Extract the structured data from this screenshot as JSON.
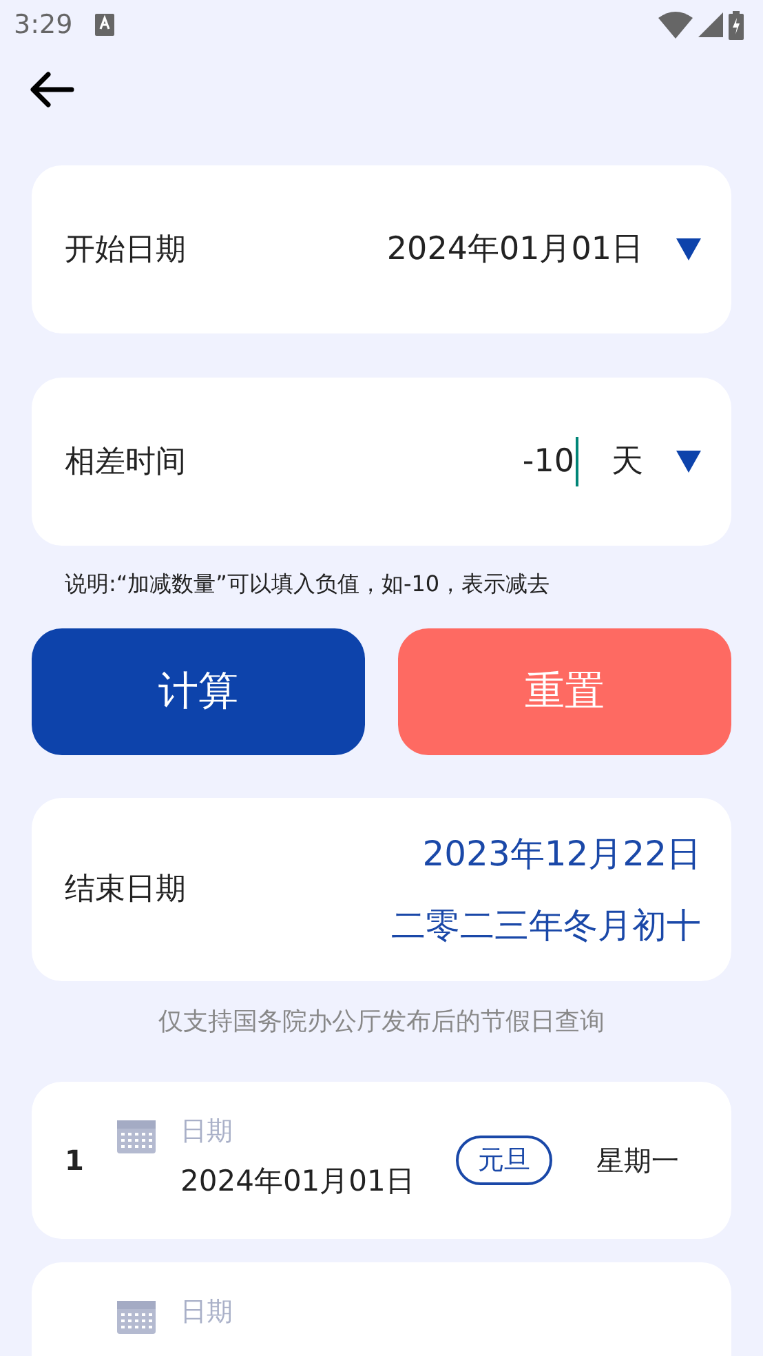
{
  "status_bar": {
    "time": "3:29"
  },
  "start_date": {
    "label": "开始日期",
    "value": "2024年01月01日"
  },
  "difference": {
    "label": "相差时间",
    "value": "-10",
    "unit": "天"
  },
  "note": "说明:“加减数量”可以填入负值，如-10，表示减去",
  "buttons": [
    {
      "label": "计算",
      "kind": "primary"
    },
    {
      "label": "重置",
      "kind": "reset"
    }
  ],
  "result": {
    "label": "结束日期",
    "date": "2023年12月22日",
    "lunar": "二零二三年冬月初十"
  },
  "holiday_notice": "仅支持国务院办公厅发布后的节假日查询",
  "holidays": [
    {
      "index": "1",
      "label": "日期",
      "date": "2024年01月01日",
      "tag": "元旦",
      "weekday": "星期一"
    },
    {
      "label": "日期"
    }
  ]
}
